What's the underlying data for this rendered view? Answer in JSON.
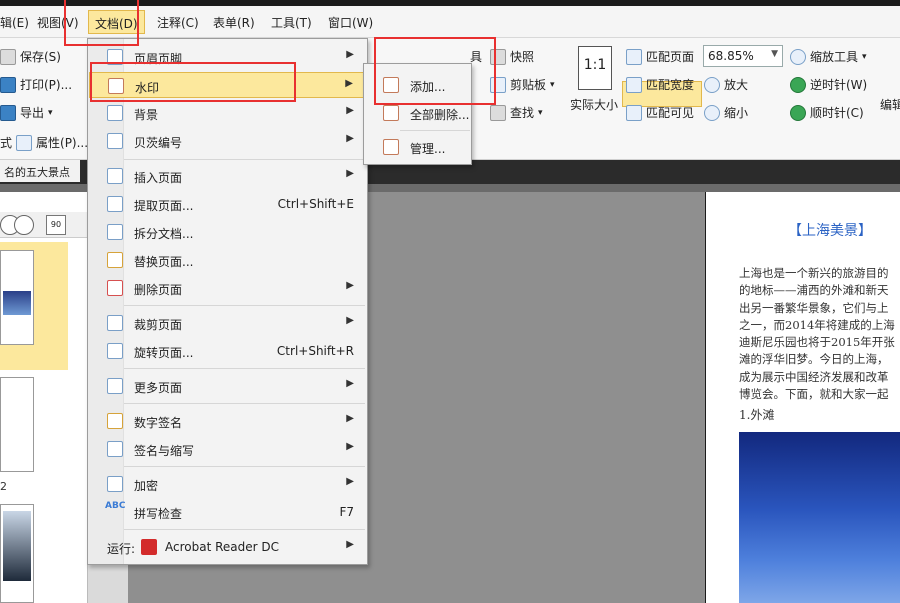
{
  "menubar": {
    "items": [
      {
        "label": "编辑(E)",
        "visible_text": "辑(E)"
      },
      {
        "label": "视图(V)"
      },
      {
        "label": "文档(D)",
        "active": true
      },
      {
        "label": "注释(C)"
      },
      {
        "label": "表单(R)"
      },
      {
        "label": "工具(T)"
      },
      {
        "label": "窗口(W)"
      }
    ]
  },
  "ribbon": {
    "left_col": [
      "保存(S)",
      "打印(P)...",
      "导出",
      "属性(P)..."
    ],
    "left_prefix": "式",
    "snapshot": "快照",
    "clipboard": "剪贴板",
    "find": "查找",
    "actual_size": "实际大小",
    "fit_page": "匹配页面",
    "fit_width": "匹配宽度",
    "fit_visible": "匹配可见",
    "zoom_value": "68.85%",
    "zoom_tool": "缩放工具",
    "zoom_in": "放大",
    "zoom_out": "缩小",
    "rotate_ccw": "逆时针(W)",
    "rotate_cw": "顺时针(C)",
    "edit_partial": "编辑",
    "partial_label": "具"
  },
  "tab": {
    "title": "名的五大景点"
  },
  "thumbnails": {
    "page_label": "2"
  },
  "document_menu": {
    "items": [
      {
        "label": "页眉页脚",
        "submenu": true
      },
      {
        "label": "水印",
        "submenu": true,
        "highlighted": true
      },
      {
        "label": "背景",
        "submenu": true
      },
      {
        "label": "贝茨编号",
        "submenu": true
      },
      {
        "label": "插入页面",
        "submenu": true
      },
      {
        "label": "提取页面...",
        "shortcut": "Ctrl+Shift+E"
      },
      {
        "label": "拆分文档..."
      },
      {
        "label": "替换页面..."
      },
      {
        "label": "删除页面",
        "submenu": true
      },
      {
        "label": "裁剪页面",
        "submenu": true
      },
      {
        "label": "旋转页面...",
        "shortcut": "Ctrl+Shift+R"
      },
      {
        "label": "更多页面",
        "submenu": true
      },
      {
        "label": "数字签名",
        "submenu": true
      },
      {
        "label": "签名与缩写",
        "submenu": true
      },
      {
        "label": "加密",
        "submenu": true
      },
      {
        "label": "拼写检查",
        "shortcut": "F7"
      },
      {
        "label": "运行:",
        "app": "Acrobat Reader DC",
        "submenu": true
      }
    ]
  },
  "watermark_submenu": {
    "items": [
      {
        "label": "添加..."
      },
      {
        "label": "全部删除..."
      },
      {
        "label": "管理..."
      }
    ]
  },
  "document_page": {
    "title": "【上海美景】",
    "paragraph_lines": [
      "上海也是一个新兴的旅游目的",
      "的地标——浦西的外滩和新天",
      "出另一番繁华景象，它们与上",
      "之一，而2014年将建成的上海",
      "迪斯尼乐园也将于2015年开张",
      "滩的浮华旧梦。今日的上海，",
      "成为展示中国经济发展和改革",
      "博览会。下面，就和大家一起"
    ],
    "section": "1.外滩"
  },
  "colors": {
    "highlight": "#fce89d",
    "annotation_red": "#e83030",
    "title_blue": "#2a62c4"
  }
}
